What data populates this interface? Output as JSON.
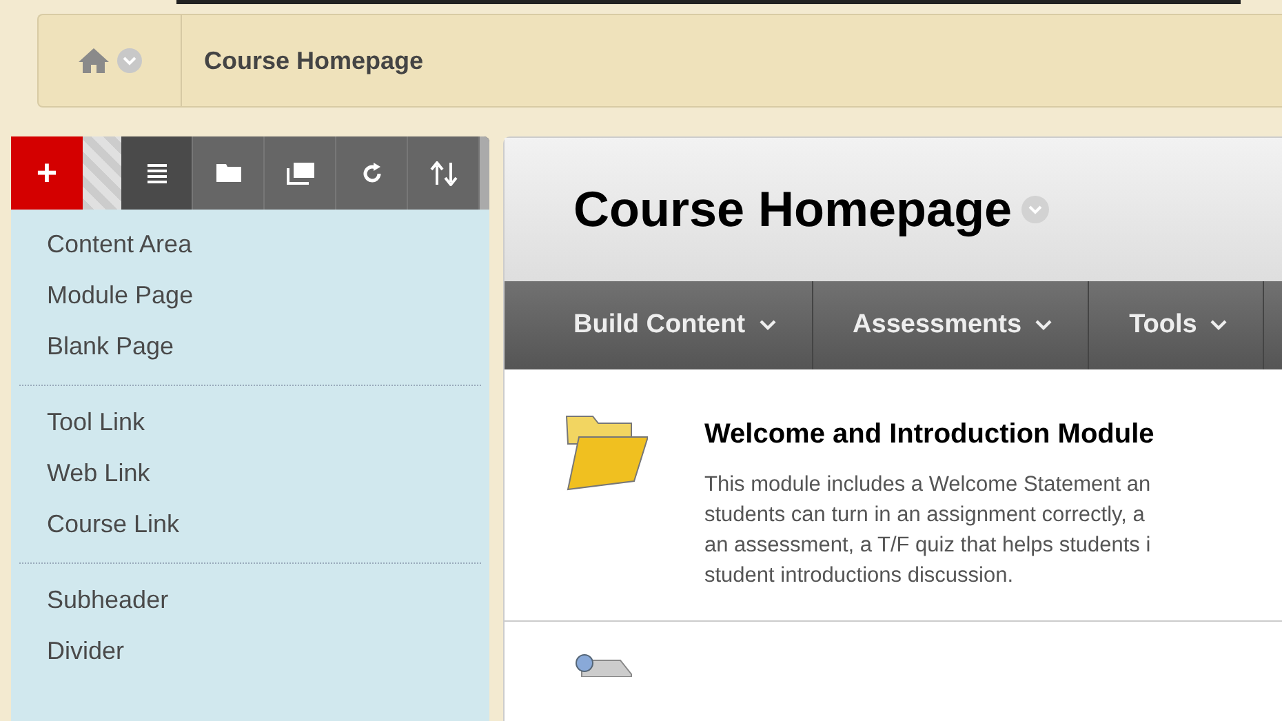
{
  "breadcrumb": {
    "current": "Course Homepage"
  },
  "toolbar": [
    {
      "kind": "add",
      "label": "+",
      "selected": true
    },
    {
      "kind": "list",
      "selected": true
    },
    {
      "kind": "folder",
      "selected": false
    },
    {
      "kind": "windows",
      "selected": false
    },
    {
      "kind": "refresh",
      "selected": false
    },
    {
      "kind": "sort",
      "selected": false
    }
  ],
  "add_menu": {
    "groups": [
      [
        "Content Area",
        "Module Page",
        "Blank Page"
      ],
      [
        "Tool Link",
        "Web Link",
        "Course Link"
      ],
      [
        "Subheader",
        "Divider"
      ]
    ]
  },
  "page": {
    "title": "Course Homepage",
    "nav": [
      "Build Content",
      "Assessments",
      "Tools"
    ],
    "items": [
      {
        "kind": "folder",
        "title": "Welcome and Introduction Module",
        "description_lines": [
          "This module includes a Welcome Statement an",
          "students can turn in an assignment correctly, a",
          "an assessment, a T/F quiz that helps students i",
          "student introductions discussion."
        ]
      },
      {
        "kind": "pin"
      }
    ]
  }
}
